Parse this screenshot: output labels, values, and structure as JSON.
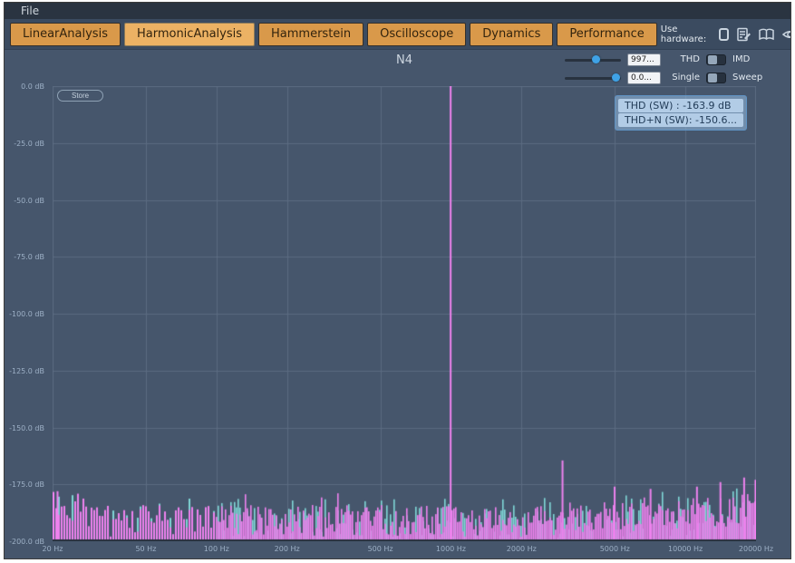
{
  "titlebar": {
    "menu_file": "File"
  },
  "tabs": {
    "labels": [
      "LinearAnalysis",
      "HarmonicAnalysis",
      "Hammerstein",
      "Oscilloscope",
      "Dynamics",
      "Performance"
    ],
    "selected": "HarmonicAnalysis"
  },
  "hardware": {
    "label": "Use hardware:",
    "icons": [
      "checkbox",
      "edit-notes-icon",
      "book-icon",
      "eye-icon",
      "camera-icon",
      "gear-icon"
    ]
  },
  "controls": {
    "frequency_value": "997...",
    "level_value": "0.0...",
    "mode_left": "THD",
    "mode_right": "IMD",
    "sweep_left": "Single",
    "sweep_right": "Sweep"
  },
  "plot": {
    "title": "N4",
    "store_label": "Store",
    "readout_line1": "THD (SW) : -163.9 dB",
    "readout_line2": "THD+N (SW): -150.6..."
  },
  "chart_data": {
    "type": "bar",
    "subtype": "fft-spectrum",
    "title": "N4",
    "x_axis": {
      "scale": "log",
      "unit": "Hz",
      "range": [
        20,
        20000
      ],
      "ticks": [
        {
          "hz": 20,
          "label": "20 Hz"
        },
        {
          "hz": 50,
          "label": "50 Hz"
        },
        {
          "hz": 100,
          "label": "100 Hz"
        },
        {
          "hz": 200,
          "label": "200 Hz"
        },
        {
          "hz": 500,
          "label": "500 Hz"
        },
        {
          "hz": 1000,
          "label": "1000 Hz"
        },
        {
          "hz": 2000,
          "label": "2000 Hz"
        },
        {
          "hz": 5000,
          "label": "5000 Hz"
        },
        {
          "hz": 10000,
          "label": "10000 Hz"
        },
        {
          "hz": 20000,
          "label": "20000 Hz"
        }
      ]
    },
    "y_axis": {
      "unit": "dB",
      "range": [
        0,
        -200
      ],
      "ticks": [
        {
          "db": 0,
          "label": "0.0 dB"
        },
        {
          "db": -25,
          "label": "-25.0 dB"
        },
        {
          "db": -50,
          "label": "-50.0 dB"
        },
        {
          "db": -75,
          "label": "-75.0 dB"
        },
        {
          "db": -100,
          "label": "-100.0 dB"
        },
        {
          "db": -125,
          "label": "-125.0 dB"
        },
        {
          "db": -150,
          "label": "-150.0 dB"
        },
        {
          "db": -175,
          "label": "-175.0 dB"
        },
        {
          "db": -200,
          "label": "-200.0 dB"
        }
      ]
    },
    "peaks": [
      {
        "hz": 997,
        "db": 0
      },
      {
        "hz": 2991,
        "db": -164.5
      },
      {
        "hz": 21,
        "db": -178
      },
      {
        "hz": 4990,
        "db": -176
      },
      {
        "hz": 7100,
        "db": -177
      },
      {
        "hz": 11200,
        "db": -176
      },
      {
        "hz": 14100,
        "db": -174
      },
      {
        "hz": 17800,
        "db": -172
      },
      {
        "hz": 19900,
        "db": -173
      }
    ],
    "noise_floor": {
      "mean_db": -191,
      "spread_db": 7,
      "hf_rise_db": 5,
      "seed": 7
    },
    "readouts": {
      "thd_db": -163.9,
      "thd_n_db": -150.6
    },
    "colors": {
      "primary": "#ee82ee",
      "secondary": "#7fd6d6",
      "plot_bg": "#46566c",
      "grid": "#5b6b81",
      "axis_line": "#26303c"
    },
    "legend": "none",
    "grid": true
  }
}
